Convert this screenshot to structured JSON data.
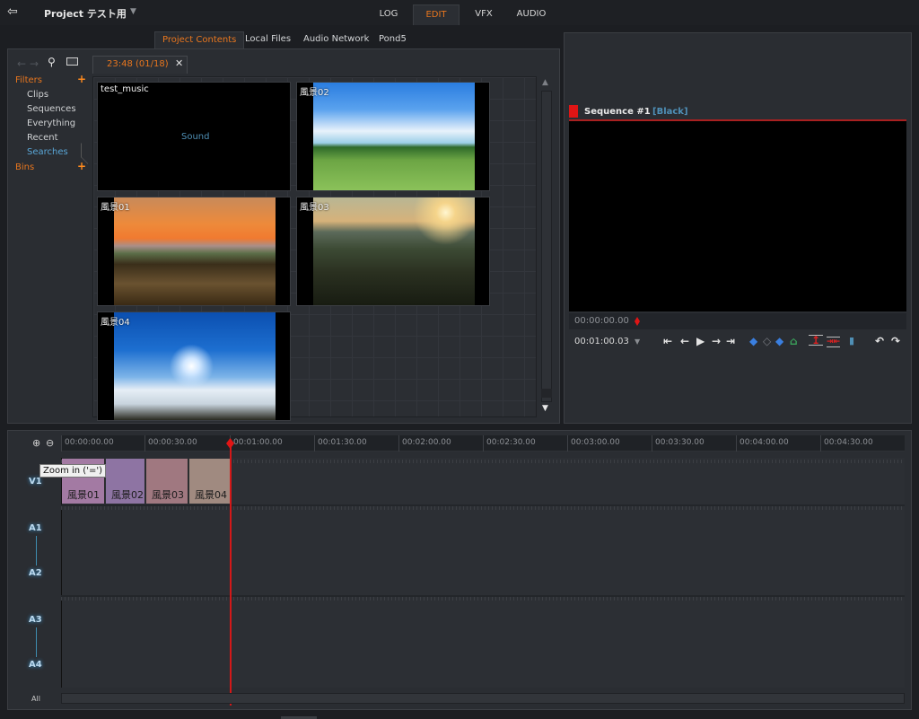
{
  "app": {
    "project_title": "Project テスト用",
    "exit_icon": "exit-icon",
    "mode_tabs": [
      {
        "label": "LOG",
        "active": false
      },
      {
        "label": "EDIT",
        "active": true
      },
      {
        "label": "VFX",
        "active": false
      },
      {
        "label": "AUDIO",
        "active": false
      }
    ]
  },
  "browser": {
    "source_tabs": [
      {
        "label": "Project Contents",
        "active": true
      },
      {
        "label": "Local Files",
        "active": false
      },
      {
        "label": "Audio Network",
        "active": false
      },
      {
        "label": "Pond5",
        "active": false
      }
    ],
    "bin_tab": "23:48 (01/18)",
    "close_glyph": "✕",
    "sidebar": {
      "filters_label": "Filters",
      "filters": [
        "Clips",
        "Sequences",
        "Everything",
        "Recent",
        "Searches"
      ],
      "selected_filter": "Searches",
      "bins_label": "Bins",
      "add_glyph": "+"
    },
    "clips": [
      {
        "name": "test_music",
        "type": "audio",
        "placeholder": "Sound"
      },
      {
        "name": "風景02",
        "type": "image",
        "scene": "green meadow under blue sky"
      },
      {
        "name": "風景01",
        "type": "image",
        "scene": "sunset over sea and fields"
      },
      {
        "name": "風景03",
        "type": "image",
        "scene": "hazy sunrise over hills"
      },
      {
        "name": "風景04",
        "type": "image",
        "scene": "sun above sea of clouds"
      }
    ]
  },
  "viewer": {
    "sequence_title": "Sequence #1",
    "sequence_tag": "[Black]",
    "scrub_timecode": "00:00:00.00",
    "duration_timecode": "00:01:00.03",
    "transport": [
      {
        "name": "go-to-start-icon",
        "glyph": "⇤"
      },
      {
        "name": "step-back-icon",
        "glyph": "←"
      },
      {
        "name": "play-icon",
        "glyph": "▶"
      },
      {
        "name": "step-forward-icon",
        "glyph": "→"
      },
      {
        "name": "go-to-end-icon",
        "glyph": "⇥"
      }
    ],
    "tools": [
      {
        "name": "mark-in-icon",
        "glyph": "◆",
        "color": "#3a7fe0"
      },
      {
        "name": "mark-clear-icon",
        "glyph": "◇",
        "color": "#777a80"
      },
      {
        "name": "mark-out-icon",
        "glyph": "◆",
        "color": "#3a7fe0"
      },
      {
        "name": "marker-icon",
        "glyph": "⌂",
        "color": "#3aa05a"
      },
      {
        "name": "lift-icon",
        "glyph": "↥",
        "color": "#e02020"
      },
      {
        "name": "extract-icon",
        "glyph": "⇥⇤",
        "color": "#e02020"
      },
      {
        "name": "voiceover-mic-icon",
        "glyph": "🎙",
        "color": "#4f8fb5"
      },
      {
        "name": "undo-icon",
        "glyph": "↶",
        "color": "#e4e4e4"
      },
      {
        "name": "redo-icon",
        "glyph": "↷",
        "color": "#e4e4e4"
      }
    ]
  },
  "timeline": {
    "ruler_ticks": [
      "00:00:00.00",
      "00:00:30.00",
      "00:01:00.00",
      "00:01:30.00",
      "00:02:00.00",
      "00:02:30.00",
      "00:03:00.00",
      "00:03:30.00",
      "00:04:00.00",
      "00:04:30.00"
    ],
    "playhead_time": "00:01:00.00",
    "tracks": [
      "V1",
      "A1",
      "A2",
      "A3",
      "A4"
    ],
    "video_clips": [
      {
        "name": "風景01",
        "color": "#a37aa3"
      },
      {
        "name": "風景02",
        "color": "#8e74a3"
      },
      {
        "name": "風景03",
        "color": "#a07880"
      },
      {
        "name": "風景04",
        "color": "#a08a80"
      }
    ],
    "tooltip": "Zoom in ('=')",
    "all_label": "All"
  }
}
